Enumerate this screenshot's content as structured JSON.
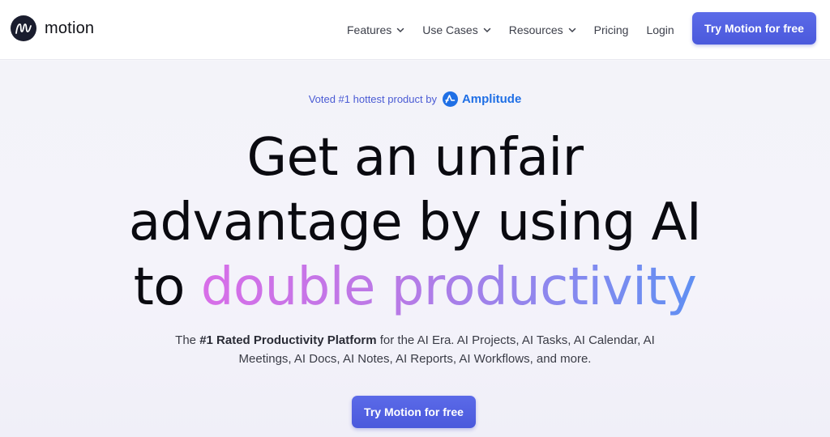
{
  "nav": {
    "logo_text": "motion",
    "links": [
      {
        "label": "Features",
        "has_dropdown": true
      },
      {
        "label": "Use Cases",
        "has_dropdown": true
      },
      {
        "label": "Resources",
        "has_dropdown": true
      },
      {
        "label": "Pricing",
        "has_dropdown": false
      },
      {
        "label": "Login",
        "has_dropdown": false
      }
    ],
    "cta_label": "Try Motion for free"
  },
  "hero": {
    "voted_text": "Voted #1 hottest product by",
    "voted_brand": "Amplitude",
    "headline_line1": "Get an unfair",
    "headline_line2": "advantage by using AI",
    "headline_line3_prefix": "to ",
    "headline_line3_highlight": "double productivity",
    "sub_prefix": "The ",
    "sub_bold": "#1 Rated Productivity Platform",
    "sub_rest": " for the AI Era. AI Projects, AI Tasks, AI Calendar, AI Meetings, AI Docs, AI Notes, AI Reports, AI Workflows, and more.",
    "cta_label": "Try Motion for free"
  },
  "colors": {
    "brand_button": "#4f5fe0",
    "accent_blue": "#4a5bd4",
    "amplitude_blue": "#1f6fe5",
    "gradient_start": "#d86ee8",
    "gradient_end": "#5f8ff2"
  },
  "icons": {
    "logo": "motion-logo-icon",
    "dropdown": "chevron-down-icon",
    "amplitude": "amplitude-logo-icon"
  }
}
